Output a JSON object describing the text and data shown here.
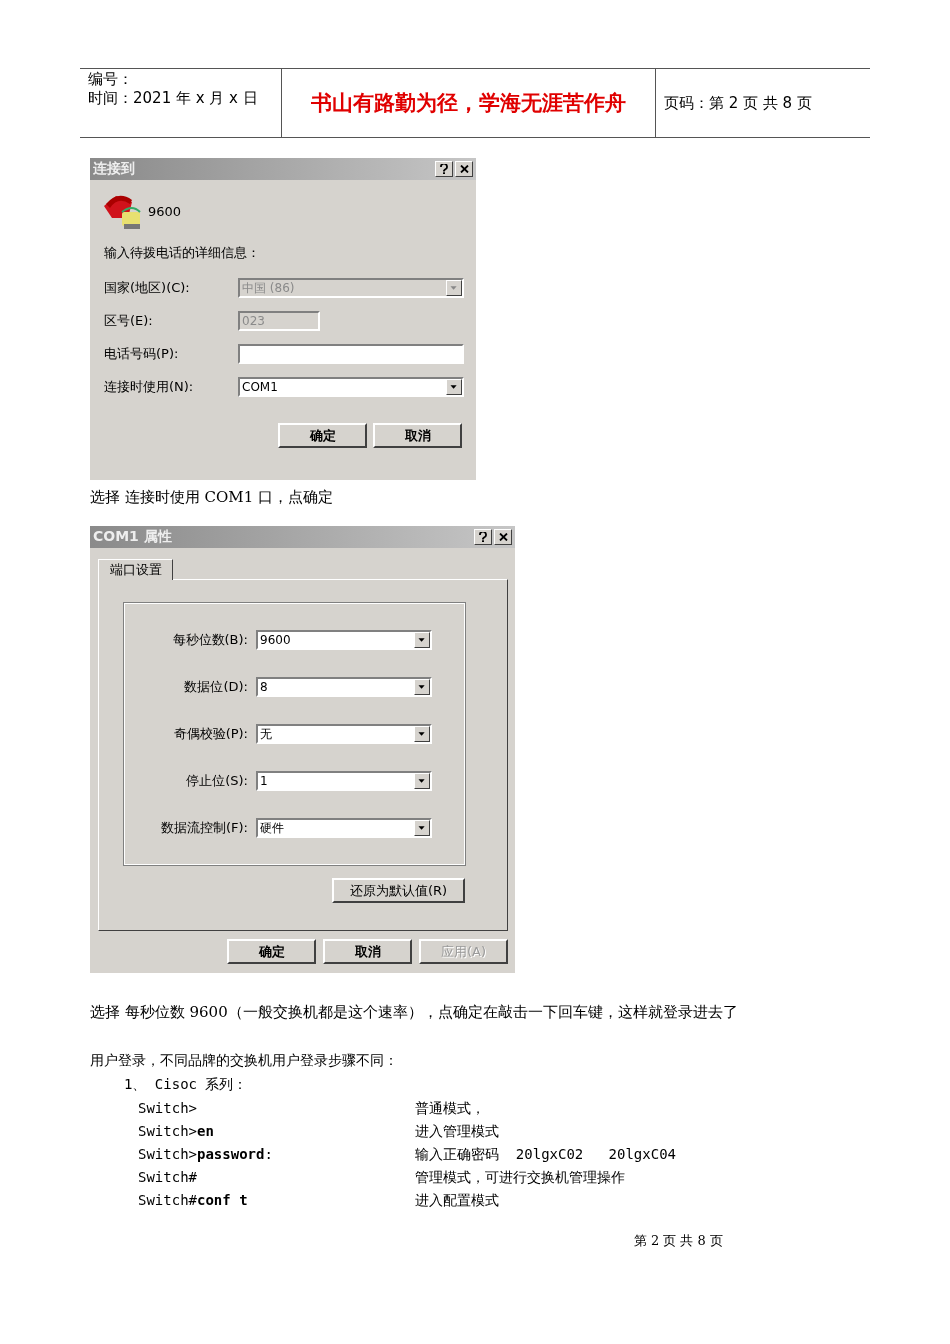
{
  "header": {
    "number_label": "编号：",
    "date": "时间：2021 年 x 月 x 日",
    "motto": "书山有路勤为径，学海无涯苦作舟",
    "page": "页码：第 2 页  共 8 页"
  },
  "connect_dialog": {
    "title": "连接到",
    "entry_name": "9600",
    "prompt": "输入待拨电话的详细信息：",
    "fields": [
      {
        "kind": "combo",
        "label": "国家(地区)(C):",
        "value": "中国 (86)",
        "disabled": true
      },
      {
        "kind": "text",
        "label": "区号(E):",
        "value": "023",
        "disabled": true
      },
      {
        "kind": "text",
        "label": "电话号码(P):",
        "disabled": false
      },
      {
        "kind": "combo",
        "label": "连接时使用(N):",
        "value": "COM1",
        "disabled": false
      }
    ],
    "buttons": [
      {
        "label": "确定",
        "disabled": false
      },
      {
        "label": "取消",
        "disabled": false
      }
    ]
  },
  "caption_1": "选择 连接时使用 COM1 口，点确定",
  "com_dialog": {
    "title": "COM1 属性",
    "tabs": [
      {
        "label": "端口设置",
        "selected": true
      }
    ],
    "fields": [
      {
        "label": "每秒位数(B):",
        "value": "9600"
      },
      {
        "label": "数据位(D):",
        "value": "8"
      },
      {
        "label": "奇偶校验(P):",
        "value": "无"
      },
      {
        "label": "停止位(S):",
        "value": "1"
      },
      {
        "label": "数据流控制(F):",
        "value": "硬件"
      }
    ],
    "restore_button": "还原为默认值(R)",
    "buttons": [
      {
        "label": "确定",
        "disabled": false
      },
      {
        "label": "取消",
        "disabled": false
      },
      {
        "label": "应用(A)",
        "disabled": true
      }
    ]
  },
  "caption_2": "选择 每秒位数 9600（一般交换机都是这个速率），点确定在敲击一下回车键，这样就登录进去了",
  "intro": "用户登录，不同品牌的交换机用户登录步骤不同：",
  "list_heading": "1、 Cisoc 系列：",
  "commands": [
    {
      "command": "Switch>",
      "description": "普通模式，"
    },
    {
      "command": "Switch>**en**",
      "description": "进入管理模式"
    },
    {
      "command": "Switch>**password**:",
      "description": "输入正确密码  20lgxC02   20lgxC04"
    },
    {
      "command": "Switch#",
      "description": "管理模式，可进行交换机管理操作"
    },
    {
      "command": "Switch#**conf t**",
      "description": "进入配置模式"
    }
  ],
  "footer": "第 2 页 共 8 页"
}
